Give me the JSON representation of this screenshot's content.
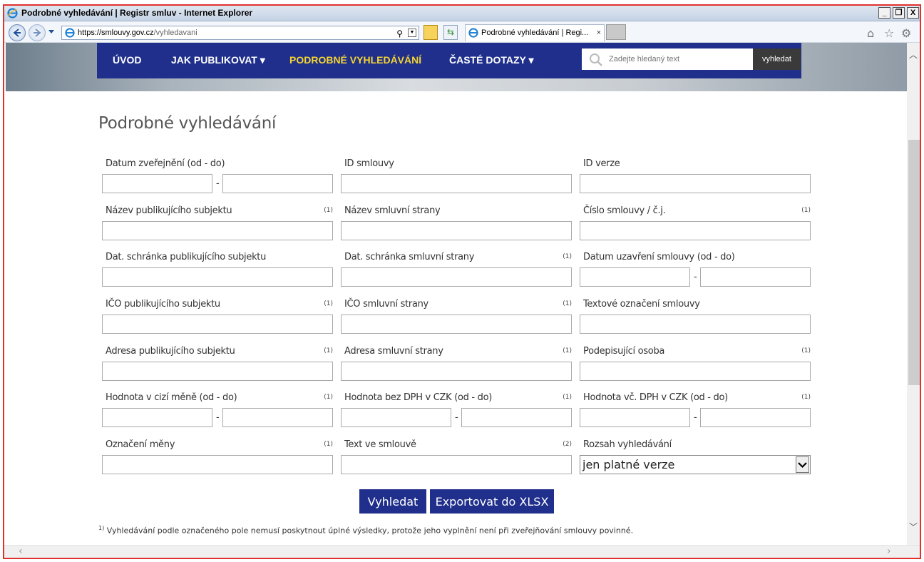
{
  "window": {
    "title": "Podrobné vyhledávání | Registr smluv - Internet Explorer",
    "minimize": "_",
    "restore": "❐",
    "close": "X"
  },
  "browser": {
    "url_host": "https://smlouvy.gov.cz",
    "url_path": "/vyhledavani",
    "tab_title": "Podrobné vyhledávání | Regi...",
    "tab_close": "×",
    "icons": [
      "back-icon",
      "forward-icon",
      "ie-icon",
      "lock-icon",
      "refresh-icon",
      "home-icon",
      "star-icon",
      "gear-icon"
    ]
  },
  "nav": {
    "items": [
      {
        "label": "ÚVOD"
      },
      {
        "label": "JAK PUBLIKOVAT ▾"
      },
      {
        "label": "PODROBNÉ VYHLEDÁVÁNÍ"
      },
      {
        "label": "ČASTÉ DOTAZY ▾"
      }
    ],
    "search_placeholder": "Zadejte hledaný text",
    "search_button": "vyhledat"
  },
  "page": {
    "title": "Podrobné vyhledávání",
    "fields": [
      {
        "label": "Datum zveřejnění (od - do)",
        "note": "",
        "type": "range"
      },
      {
        "label": "ID smlouvy",
        "note": "",
        "type": "text"
      },
      {
        "label": "ID verze",
        "note": "",
        "type": "text"
      },
      {
        "label": "Název publikujícího subjektu",
        "note": "(1)",
        "type": "text"
      },
      {
        "label": "Název smluvní strany",
        "note": "",
        "type": "text"
      },
      {
        "label": "Číslo smlouvy / č.j.",
        "note": "(1)",
        "type": "text"
      },
      {
        "label": "Dat. schránka publikujícího subjektu",
        "note": "",
        "type": "text"
      },
      {
        "label": "Dat. schránka smluvní strany",
        "note": "(1)",
        "type": "text"
      },
      {
        "label": "Datum uzavření smlouvy (od - do)",
        "note": "",
        "type": "range"
      },
      {
        "label": "IČO publikujícího subjektu",
        "note": "(1)",
        "type": "text"
      },
      {
        "label": "IČO smluvní strany",
        "note": "(1)",
        "type": "text"
      },
      {
        "label": "Textové označení smlouvy",
        "note": "",
        "type": "text"
      },
      {
        "label": "Adresa publikujícího subjektu",
        "note": "(1)",
        "type": "text"
      },
      {
        "label": "Adresa smluvní strany",
        "note": "(1)",
        "type": "text"
      },
      {
        "label": "Podepisující osoba",
        "note": "(1)",
        "type": "text"
      },
      {
        "label": "Hodnota v cizí měně (od - do)",
        "note": "(1)",
        "type": "range"
      },
      {
        "label": "Hodnota bez DPH v CZK (od - do)",
        "note": "(1)",
        "type": "range"
      },
      {
        "label": "Hodnota vč. DPH v CZK (od - do)",
        "note": "(1)",
        "type": "range"
      },
      {
        "label": "Označení měny",
        "note": "(1)",
        "type": "text"
      },
      {
        "label": "Text ve smlouvě",
        "note": "(2)",
        "type": "text"
      },
      {
        "label": "Rozsah vyhledávání",
        "note": "",
        "type": "select",
        "value": "jen platné verze"
      }
    ],
    "range_separator": "-",
    "search_button": "Vyhledat",
    "export_button": "Exportovat do XLSX",
    "footnote_mark": "1)",
    "footnote": "Vyhledávání podle označeného pole nemusí poskytnout úplné výsledky, protože jeho vyplnění není při zveřejňování smlouvy povinné."
  },
  "colors": {
    "nav_bg": "#1f2f8b",
    "nav_active": "#f5d533",
    "button_bg": "#1f2f8b",
    "frame_border": "#e0312d"
  }
}
